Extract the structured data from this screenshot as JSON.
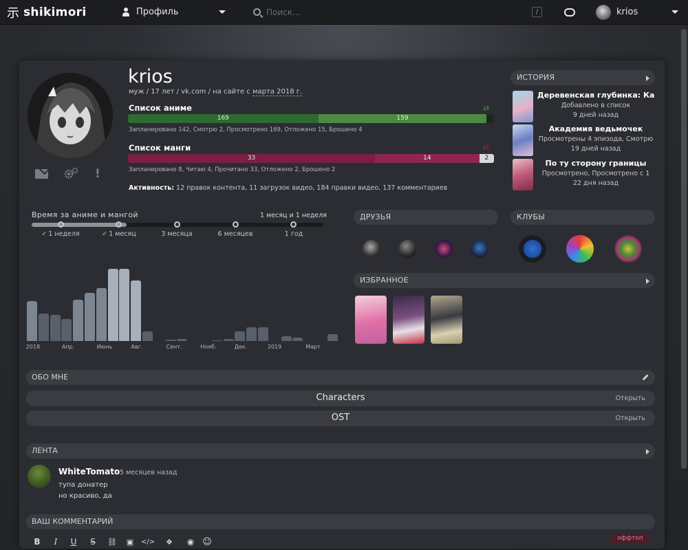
{
  "nav": {
    "logo_text": "shikimori",
    "profile_label": "Профиль",
    "search_placeholder": "Поиск...",
    "search_shortcut": "/",
    "username": "krios"
  },
  "profile": {
    "name": "krios",
    "meta_prefix": "муж / 17 лет / vk.com / на сайте с ",
    "meta_date": "марта 2018 г.",
    "anime_list_title": "Список аниме",
    "anime_bar": [
      {
        "value": "169",
        "share": 0.52,
        "color": "#2e6b2f"
      },
      {
        "value": "159",
        "share": 0.46,
        "color": "#4c8a44"
      },
      {
        "value": "",
        "share": 0.02,
        "color": "#1b2a1b"
      }
    ],
    "anime_stats": "Запланировано 142, Смотрю 2, Просмотрено 169, Отложено 15, Брошено 4",
    "manga_list_title": "Список манги",
    "manga_bar": [
      {
        "value": "33",
        "share": 0.675,
        "color": "#7a1f43"
      },
      {
        "value": "14",
        "share": 0.285,
        "color": "#8e2750"
      },
      {
        "value": "2",
        "share": 0.04,
        "color": "#d6d8dc"
      }
    ],
    "manga_stats": "Запланировано 8, Читаю 4, Прочитано 33, Отложено 2, Брошено 2",
    "activity_label": "Активность:",
    "activity_text": " 12 правок контента, 11 загрузок видео, 184 правки видео, 137 комментариев"
  },
  "history": {
    "header": "ИСТОРИЯ",
    "items": [
      {
        "title": "Деревенская глубинка: Ка...",
        "line1": "Добавлено в список",
        "line2": "9 дней назад"
      },
      {
        "title": "Академия ведьмочек",
        "line1": "Просмотрены 4 эпизода, Смотрю",
        "line2": "19 дней назад"
      },
      {
        "title": "По ту сторону границы",
        "line1": "Просмотрено, Просмотрено с 1",
        "line2": "22 дня назад"
      }
    ]
  },
  "time": {
    "title": "Время за аниме и мангой",
    "value": "1 месяц и 1 неделя",
    "scale": [
      "1 неделя",
      "1 месяц",
      "3 месяца",
      "6 месяцев",
      "1 год"
    ]
  },
  "chart_data": {
    "type": "bar",
    "title": "",
    "x_ticks": [
      "2018",
      "Апр.",
      "Июнь",
      "Авг.",
      "Сент.",
      "Нояб.",
      "Дек.",
      "2019",
      "Март"
    ],
    "values": [
      58,
      40,
      38,
      32,
      60,
      70,
      77,
      105,
      105,
      88,
      14,
      0,
      2,
      3,
      0,
      0,
      1,
      3,
      14,
      20,
      20,
      0,
      7,
      5,
      0,
      0,
      10
    ],
    "ylim": [
      0,
      108
    ]
  },
  "friends": {
    "header": "ДРУЗЬЯ"
  },
  "clubs": {
    "header": "КЛУБЫ"
  },
  "favorites": {
    "header": "ИЗБРАННОЕ"
  },
  "about": {
    "header": "ОБО МНЕ",
    "spoilers": [
      {
        "title": "Characters",
        "open": "Открыть"
      },
      {
        "title": "OST",
        "open": "Открыть"
      }
    ]
  },
  "feed": {
    "header": "ЛЕНТА",
    "author": "WhiteTomato",
    "time": "5 месяцев назад",
    "line1": "тупа донатер",
    "line2": "но красиво, да"
  },
  "comment": {
    "header": "ВАШ КОММЕНТАРИЙ",
    "toolbar": [
      "B",
      "I",
      "U",
      "S"
    ],
    "offtop": "оффтоп"
  },
  "colors": {
    "accent_green": "#4c8a44",
    "accent_crimson": "#8e2750",
    "bar_dark": "#59606b",
    "bar_light": "#a8b0bc"
  }
}
